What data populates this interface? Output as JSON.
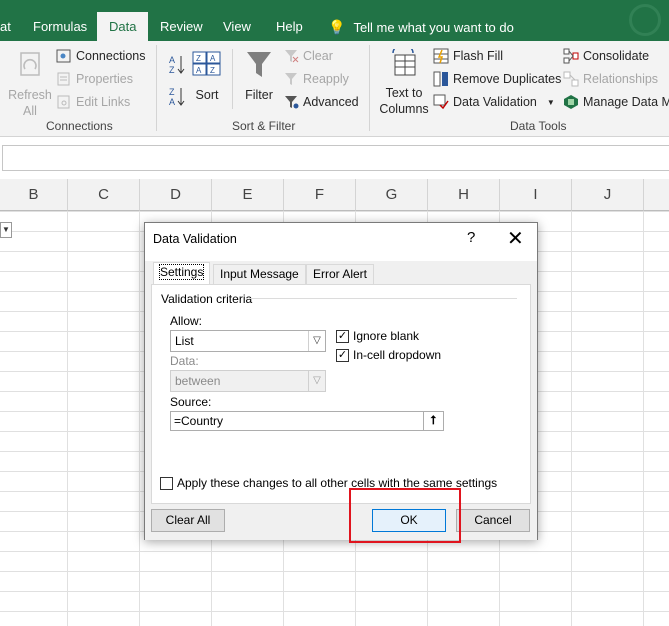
{
  "tabs": {
    "t0": "at",
    "t1": "Formulas",
    "t2": "Data",
    "t3": "Review",
    "t4": "View",
    "t5": "Help",
    "tell_me": "Tell me what you want to do"
  },
  "ribbon": {
    "refresh_all": "Refresh\nAll",
    "refresh_line1": "Refresh",
    "refresh_line2": "All",
    "connections": "Connections",
    "properties": "Properties",
    "edit_links": "Edit Links",
    "group_connections": "Connections",
    "sort": "Sort",
    "filter": "Filter",
    "clear": "Clear",
    "reapply": "Reapply",
    "advanced": "Advanced",
    "group_sort_filter": "Sort & Filter",
    "text_to_columns_1": "Text to",
    "text_to_columns_2": "Columns",
    "flash_fill": "Flash Fill",
    "remove_duplicates": "Remove Duplicates",
    "data_validation": "Data Validation",
    "consolidate": "Consolidate",
    "relationships": "Relationships",
    "manage_data_model": "Manage Data Mo",
    "group_data_tools": "Data Tools"
  },
  "columns": [
    "B",
    "C",
    "D",
    "E",
    "F",
    "G",
    "H",
    "I",
    "J"
  ],
  "dialog": {
    "title": "Data Validation",
    "help": "?",
    "close": "✕",
    "tabs": [
      "Settings",
      "Input Message",
      "Error Alert"
    ],
    "criteria_label": "Validation criteria",
    "allow_label": "Allow:",
    "allow_value": "List",
    "data_label": "Data:",
    "data_value": "between",
    "ignore_blank": "Ignore blank",
    "ignore_blank_checked": true,
    "in_cell_dropdown": "In-cell dropdown",
    "in_cell_dropdown_checked": true,
    "source_label": "Source:",
    "source_value": "=Country",
    "apply_all": "Apply these changes to all other cells with the same settings",
    "apply_all_checked": false,
    "clear_all": "Clear All",
    "ok": "OK",
    "cancel": "Cancel"
  },
  "colors": {
    "ribbon_green": "#217346",
    "highlight_red": "#e0141e",
    "ok_border": "#0078d7"
  }
}
